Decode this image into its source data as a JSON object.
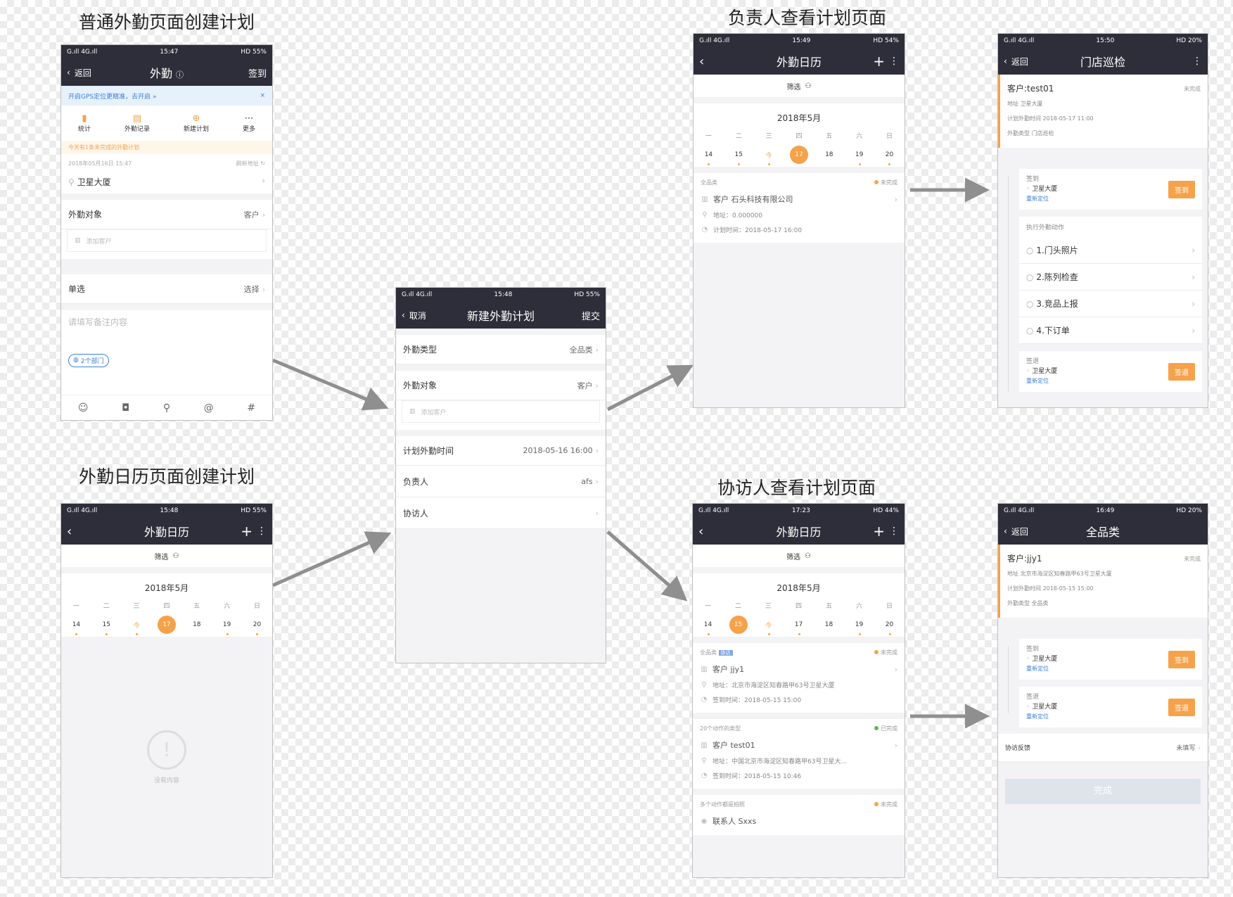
{
  "headings": {
    "h1": "普通外勤页面创建计划",
    "h2": "外勤日历页面创建计划",
    "h3": "负责人查看计划页面",
    "h4": "协访人查看计划页面"
  },
  "phone1": {
    "status": {
      "signal": "G.ıll 4G.ıll",
      "time": "15:47",
      "right": "HD 55%"
    },
    "nav": {
      "back": "返回",
      "title": "外勤",
      "right": "签到"
    },
    "gps_notice": "开启GPS定位更精准，去开启 »",
    "actions": [
      "统计",
      "外勤记录",
      "新建计划",
      "更多"
    ],
    "pending": "今天有1条未完成的外勤计划",
    "datetime": "2018年05月16日 15:47",
    "refresh": "刷新地址",
    "location": "卫星大厦",
    "target_label": "外勤对象",
    "target_value": "客户",
    "add_customer": "添加客户",
    "single_label": "单选",
    "single_value": "选择",
    "remark_placeholder": "请填写备注内容",
    "dept_tag": "2个部门"
  },
  "phone2": {
    "status": {
      "signal": "G.ıll 4G.ıll",
      "time": "15:48",
      "right": "HD 55%"
    },
    "nav": {
      "title": "外勤日历"
    },
    "filter": "筛选",
    "month": "2018年5月",
    "weekdays": [
      "一",
      "二",
      "三",
      "四",
      "五",
      "六",
      "日"
    ],
    "days": [
      "14",
      "15",
      "今",
      "17",
      "18",
      "19",
      "20"
    ],
    "empty": "没有内容"
  },
  "phone3": {
    "status": {
      "signal": "G.ıll 4G.ıll",
      "time": "15:48",
      "right": "HD 55%"
    },
    "nav": {
      "cancel": "取消",
      "title": "新建外勤计划",
      "submit": "提交"
    },
    "type_label": "外勤类型",
    "type_value": "全品类",
    "target_label": "外勤对象",
    "target_value": "客户",
    "add_customer": "添加客户",
    "time_label": "计划外勤时间",
    "time_value": "2018-05-16 16:00",
    "owner_label": "负责人",
    "owner_value": "afs",
    "assist_label": "协访人"
  },
  "phone4": {
    "status": {
      "signal": "G.ıll 4G.ıll",
      "time": "15:49",
      "right": "HD 54%"
    },
    "nav": {
      "title": "外勤日历"
    },
    "filter": "筛选",
    "month": "2018年5月",
    "weekdays": [
      "一",
      "二",
      "三",
      "四",
      "五",
      "六",
      "日"
    ],
    "days": [
      "14",
      "15",
      "今",
      "17",
      "18",
      "19",
      "20"
    ],
    "card": {
      "category": "全品类",
      "status": "未完成",
      "customer": "客户  石头科技有限公司",
      "address": "地址：0.000000",
      "time": "计划时间：2018-05-17 16:00"
    }
  },
  "phone5": {
    "status": {
      "signal": "G.ıll 4G.ıll",
      "time": "15:50",
      "right": "HD 20%"
    },
    "nav": {
      "back": "返回",
      "title": "门店巡检"
    },
    "customer": "客户:test01",
    "status_text": "未完成",
    "address": "地址  卫星大厦",
    "plan_time": "计划外勤时间  2018-05-17 11:00",
    "type": "外勤类型  门店巡检",
    "checkin_label": "签到",
    "checkin_place": "卫星大厦",
    "relocate": "重新定位",
    "checkin_btn": "签到",
    "actions_title": "执行外勤动作",
    "actions": [
      "1.门头照片",
      "2.陈列检查",
      "3.竞品上报",
      "4.下订单"
    ],
    "checkout_label": "签退",
    "checkout_place": "卫星大厦",
    "checkout_btn": "签退"
  },
  "phone6": {
    "status": {
      "signal": "G.ıll 4G.ıll",
      "time": "17:23",
      "right": "HD 44%"
    },
    "nav": {
      "title": "外勤日历"
    },
    "filter": "筛选",
    "month": "2018年5月",
    "weekdays": [
      "一",
      "二",
      "三",
      "四",
      "五",
      "六",
      "日"
    ],
    "days": [
      "14",
      "15",
      "今",
      "17",
      "18",
      "19",
      "20"
    ],
    "cards": [
      {
        "category": "全品类",
        "tag": "协访",
        "status": "未完成",
        "customer": "客户  jjy1",
        "address": "地址：北京市海淀区知春路甲63号卫星大厦",
        "time": "签到时间：2018-05-15 15:00"
      },
      {
        "category": "20个动作的类型",
        "tag": "",
        "status": "已完成",
        "customer": "客户  test01",
        "address": "地址：中国北京市海淀区知春路甲63号卫星大...",
        "time": "签到时间：2018-05-15 10:46"
      },
      {
        "category": "多个动作都是拍照",
        "tag": "",
        "status": "未完成",
        "customer": "联系人  Sxxs",
        "address": "",
        "time": ""
      }
    ]
  },
  "phone7": {
    "status": {
      "signal": "G.ıll 4G.ıll",
      "time": "16:49",
      "right": "HD 20%"
    },
    "nav": {
      "back": "返回",
      "title": "全品类"
    },
    "customer": "客户:jjy1",
    "status_text": "未完成",
    "address": "地址  北京市海淀区知春路甲63号卫星大厦",
    "plan_time": "计划外勤时间  2018-05-15 15:00",
    "type": "外勤类型  全品类",
    "checkin_label": "签到",
    "checkin_place": "卫星大厦",
    "relocate": "重新定位",
    "checkin_btn": "签到",
    "checkout_label": "签退",
    "checkout_place": "卫星大厦",
    "checkout_btn": "签退",
    "feedback_label": "协访反馈",
    "feedback_value": "未填写",
    "done_btn": "完成"
  },
  "colors": {
    "nav_bg": "#2e2e3a",
    "accent": "#f5a24a",
    "arrow": "#8f8f8f",
    "link": "#3b7fd6"
  }
}
